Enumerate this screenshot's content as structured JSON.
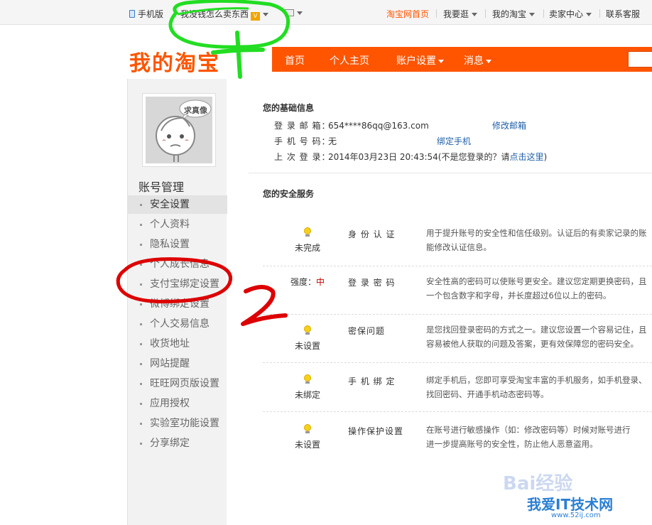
{
  "topbar": {
    "mobile_label": "手机版",
    "greeting": "我没钱怎么卖东西",
    "level_icon": "V",
    "links": [
      "淘宝网首页",
      "我要逛",
      "我的淘宝",
      "卖家中心",
      "联系客服"
    ]
  },
  "header": {
    "logo": "我的淘宝",
    "nav": [
      "首页",
      "个人主页",
      "账户设置",
      "消息"
    ]
  },
  "sidebar": {
    "avatar_badge": "求真像",
    "title": "账号管理",
    "items": [
      "安全设置",
      "个人资料",
      "隐私设置",
      "个人成长信息",
      "支付宝绑定设置",
      "微博绑定设置",
      "个人交易信息",
      "收货地址",
      "网站提醒",
      "旺旺网页版设置",
      "应用授权",
      "实验室功能设置",
      "分享绑定"
    ]
  },
  "basic_info": {
    "title": "您的基础信息",
    "email_label": "登 录 邮 箱：",
    "email_value": "654****86qq@163.com",
    "email_action": "修改邮箱",
    "phone_label": "手 机 号 码：",
    "phone_value": "无",
    "phone_action": "绑定手机",
    "last_login_label": "上 次 登 录：",
    "last_login_value": "2014年03月23日 20:43:54(不是您登录的？请",
    "last_login_action": "点击这里",
    "last_login_suffix": ")"
  },
  "security": {
    "title": "您的安全服务",
    "services": [
      {
        "status": "未完成",
        "name": "身 份 认 证",
        "desc1": "用于提升账号的安全性和信任级别。认证后的有卖家记录的账",
        "desc2": "能修改认证信息。"
      },
      {
        "status_label": "强度：",
        "status_value": "中",
        "name": "登 录 密 码",
        "desc1": "安全性高的密码可以使账号更安全。建议您定期更换密码，且",
        "desc2": "一个包含数字和字母，并长度超过6位以上的密码。"
      },
      {
        "status": "未设置",
        "name": "密保问题",
        "desc1": "是您找回登录密码的方式之一。建议您设置一个容易记住，且",
        "desc2": "容易被他人获取的问题及答案，更有效保障您的密码安全。"
      },
      {
        "status": "未绑定",
        "name": "手 机 绑 定",
        "desc1": "绑定手机后，您即可享受淘宝丰富的手机服务，如手机登录、",
        "desc2": "找回密码、开通手机动态密码等。"
      },
      {
        "status": "未设置",
        "name": "操作保护设置",
        "desc1": "在账号进行敏感操作（如：修改密码等）时候对账号进行",
        "desc2": "进一步提高账号的安全性，防止他人恶意盗用。"
      }
    ]
  },
  "annotations": {
    "mark1": "1",
    "mark2": "2"
  },
  "watermark": {
    "brand": "Bai经验",
    "site": "我爱IT技术网",
    "url": "www.52ij.com"
  },
  "colors": {
    "taobao_orange": "#ff5500",
    "annotation_green": "#22dd22",
    "annotation_red": "#dd0000",
    "link_blue": "#1f5fa8"
  }
}
